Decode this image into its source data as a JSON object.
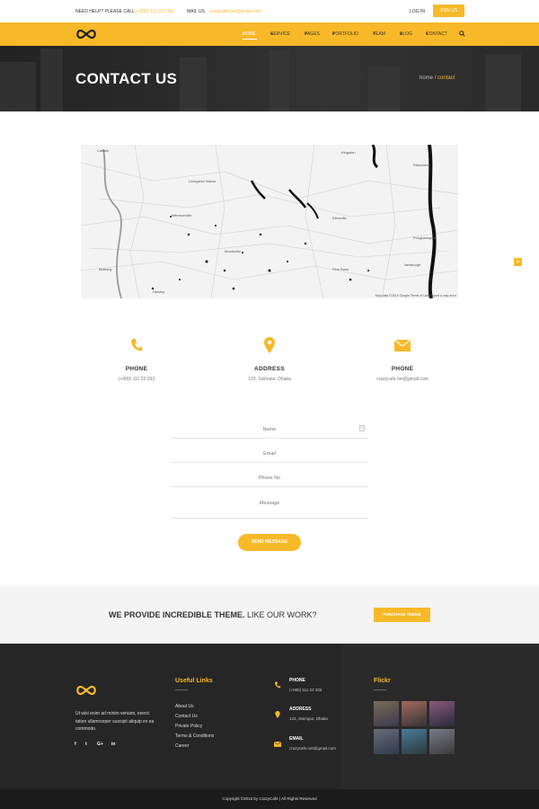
{
  "topbar": {
    "need_help": "NEED HELP? PLEASE CALL",
    "phone": "(+000) 111 222 333",
    "mail_label": "MAIL US",
    "mail": "crazycafe.net@gmail.com",
    "login": "LOG IN",
    "join": "JOIN US"
  },
  "nav": {
    "items": [
      "HOME",
      "SERVICE",
      "PAGES",
      "PORTFOLIO",
      "TEAM",
      "BLOG",
      "CONTACT"
    ]
  },
  "hero": {
    "title": "CONTACT US",
    "crumb_home": "home",
    "crumb_current": "/ contact"
  },
  "map": {
    "footer": "Map data ©2016 Google    Terms of Use    Report a map error"
  },
  "info": [
    {
      "title": "PHONE",
      "value": "(+000) 111 22 333",
      "icon": "phone-icon"
    },
    {
      "title": "ADDRESS",
      "value": "123, Sisimpur, Dhaka",
      "icon": "map-pin-icon"
    },
    {
      "title": "PHONE",
      "value": "crazycafe.net@gmail.com",
      "icon": "envelope-icon"
    }
  ],
  "form": {
    "name_placeholder": "Name",
    "email_placeholder": "Email",
    "phone_placeholder": "Phone No",
    "message_placeholder": "Message",
    "send": "SEND MESSAGE"
  },
  "promo": {
    "bold": "WE PROVIDE INCREDIBLE THEME.",
    "light": "LIKE OUR WORK?",
    "button": "PURCHASE THEME"
  },
  "footer": {
    "description": "Ut wisi enim ad minim veniam, exerci tation ullamcorper suscipit aliquip ex ea commodo.",
    "social": [
      "f",
      "t",
      "G+",
      "in"
    ],
    "useful_title": "Useful Links",
    "links": [
      "About Us",
      "Contact Us",
      "Private Policy",
      "Terms & Conditions",
      "Career"
    ],
    "contact": [
      {
        "label": "PHONE",
        "value": "(+000) 111 22 333"
      },
      {
        "label": "ADDRESS",
        "value": "123, Sisimpur, Dhaka"
      },
      {
        "label": "EMAIL",
        "value": "crazycafe.net@gmail.com"
      }
    ],
    "flickr_title": "Flickr",
    "copyright": "Copyright ©2016 by CrazyCafe  |  All Rights Reserved"
  },
  "colors": {
    "accent": "#f7b928",
    "dark": "#262626"
  }
}
